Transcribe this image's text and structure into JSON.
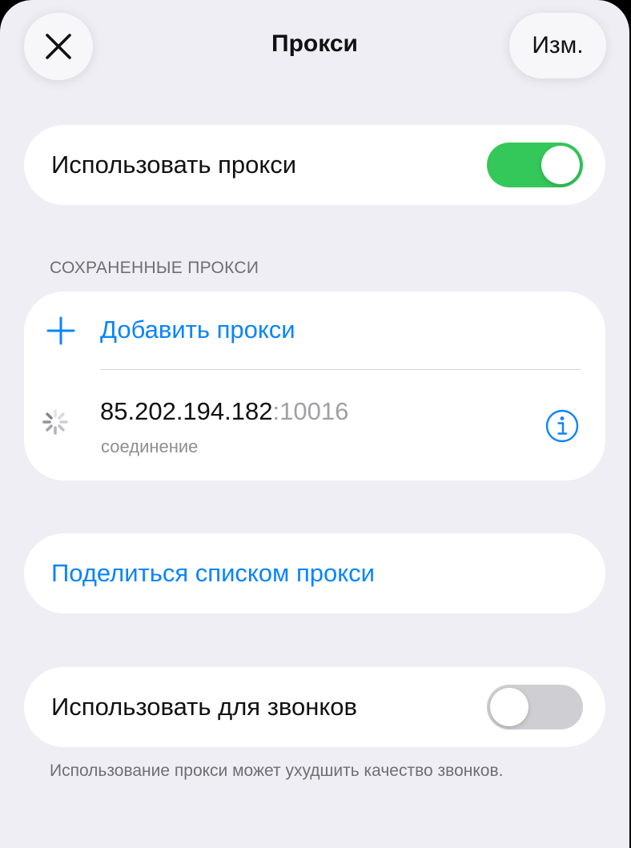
{
  "header": {
    "title": "Прокси",
    "edit_label": "Изм."
  },
  "use_proxy": {
    "label": "Использовать прокси",
    "enabled": true
  },
  "saved_proxies": {
    "section_title": "СОХРАНЕННЫЕ ПРОКСИ",
    "add_label": "Добавить прокси",
    "items": [
      {
        "host": "85.202.194.182",
        "port": ":10016",
        "status": "соединение"
      }
    ]
  },
  "share": {
    "label": "Поделиться списком прокси"
  },
  "use_for_calls": {
    "label": "Использовать для звонков",
    "enabled": false,
    "note": "Использование прокси может ухудшить качество звонков."
  },
  "colors": {
    "accent": "#0a84ff",
    "toggle_on": "#34c759",
    "toggle_off": "#cfcfd3",
    "background": "#efeef4"
  }
}
